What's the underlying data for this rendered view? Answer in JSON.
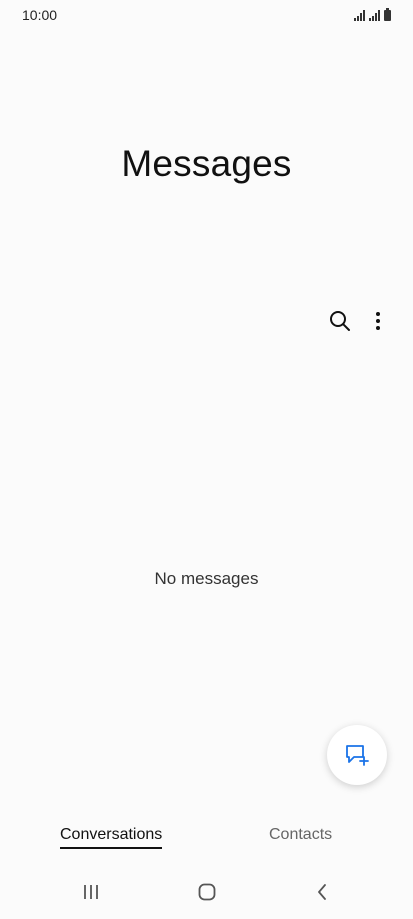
{
  "status_bar": {
    "time": "10:00"
  },
  "header": {
    "title": "Messages"
  },
  "toolbar": {
    "search_icon": "search-icon",
    "more_icon": "more-vert-icon"
  },
  "main": {
    "empty_text": "No messages"
  },
  "fab": {
    "icon": "new-message-icon",
    "accent_color": "#1a73e8"
  },
  "tabs": [
    {
      "label": "Conversations",
      "active": true
    },
    {
      "label": "Contacts",
      "active": false
    }
  ],
  "nav_bar": {
    "icons": [
      "recents-icon",
      "home-icon",
      "back-icon"
    ]
  }
}
